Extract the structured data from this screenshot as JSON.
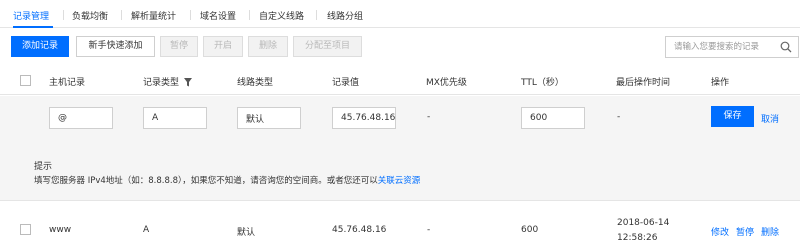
{
  "tabs": [
    {
      "label": "记录管理",
      "active": true
    },
    {
      "label": "负载均衡"
    },
    {
      "label": "解析量统计"
    },
    {
      "label": "域名设置"
    },
    {
      "label": "自定义线路"
    },
    {
      "label": "线路分组"
    }
  ],
  "toolbar": {
    "add_record": "添加记录",
    "quick_add": "新手快速添加",
    "pause": "暂停",
    "enable": "开启",
    "delete": "删除",
    "assign_project": "分配至项目",
    "search_placeholder": "请输入您要搜索的记录"
  },
  "columns": {
    "host": "主机记录",
    "type": "记录类型",
    "line": "线路类型",
    "value": "记录值",
    "mx": "MX优先级",
    "ttl": "TTL（秒）",
    "last_op": "最后操作时间",
    "actions": "操作"
  },
  "edit_row": {
    "host": "@",
    "type": "A",
    "line": "默认",
    "value": "45.76.48.16",
    "mx": "-",
    "ttl": "600",
    "last_op": "-",
    "save": "保存",
    "cancel": "取消"
  },
  "hint": {
    "title": "提示",
    "text": "填写您服务器 IPv4地址（如：8.8.8.8），如果您不知道，请咨询您的空间商。或者您还可以",
    "link": "关联云资源"
  },
  "records": [
    {
      "host": "www",
      "type": "A",
      "line": "默认",
      "value": "45.76.48.16",
      "mx": "-",
      "ttl": "600",
      "date": "2018-06-14",
      "time": "12:58:26",
      "action_edit": "修改",
      "action_pause": "暂停",
      "action_delete": "删除"
    }
  ],
  "colors": {
    "accent": "#006eff",
    "panel_bg": "#f5f5f5"
  }
}
